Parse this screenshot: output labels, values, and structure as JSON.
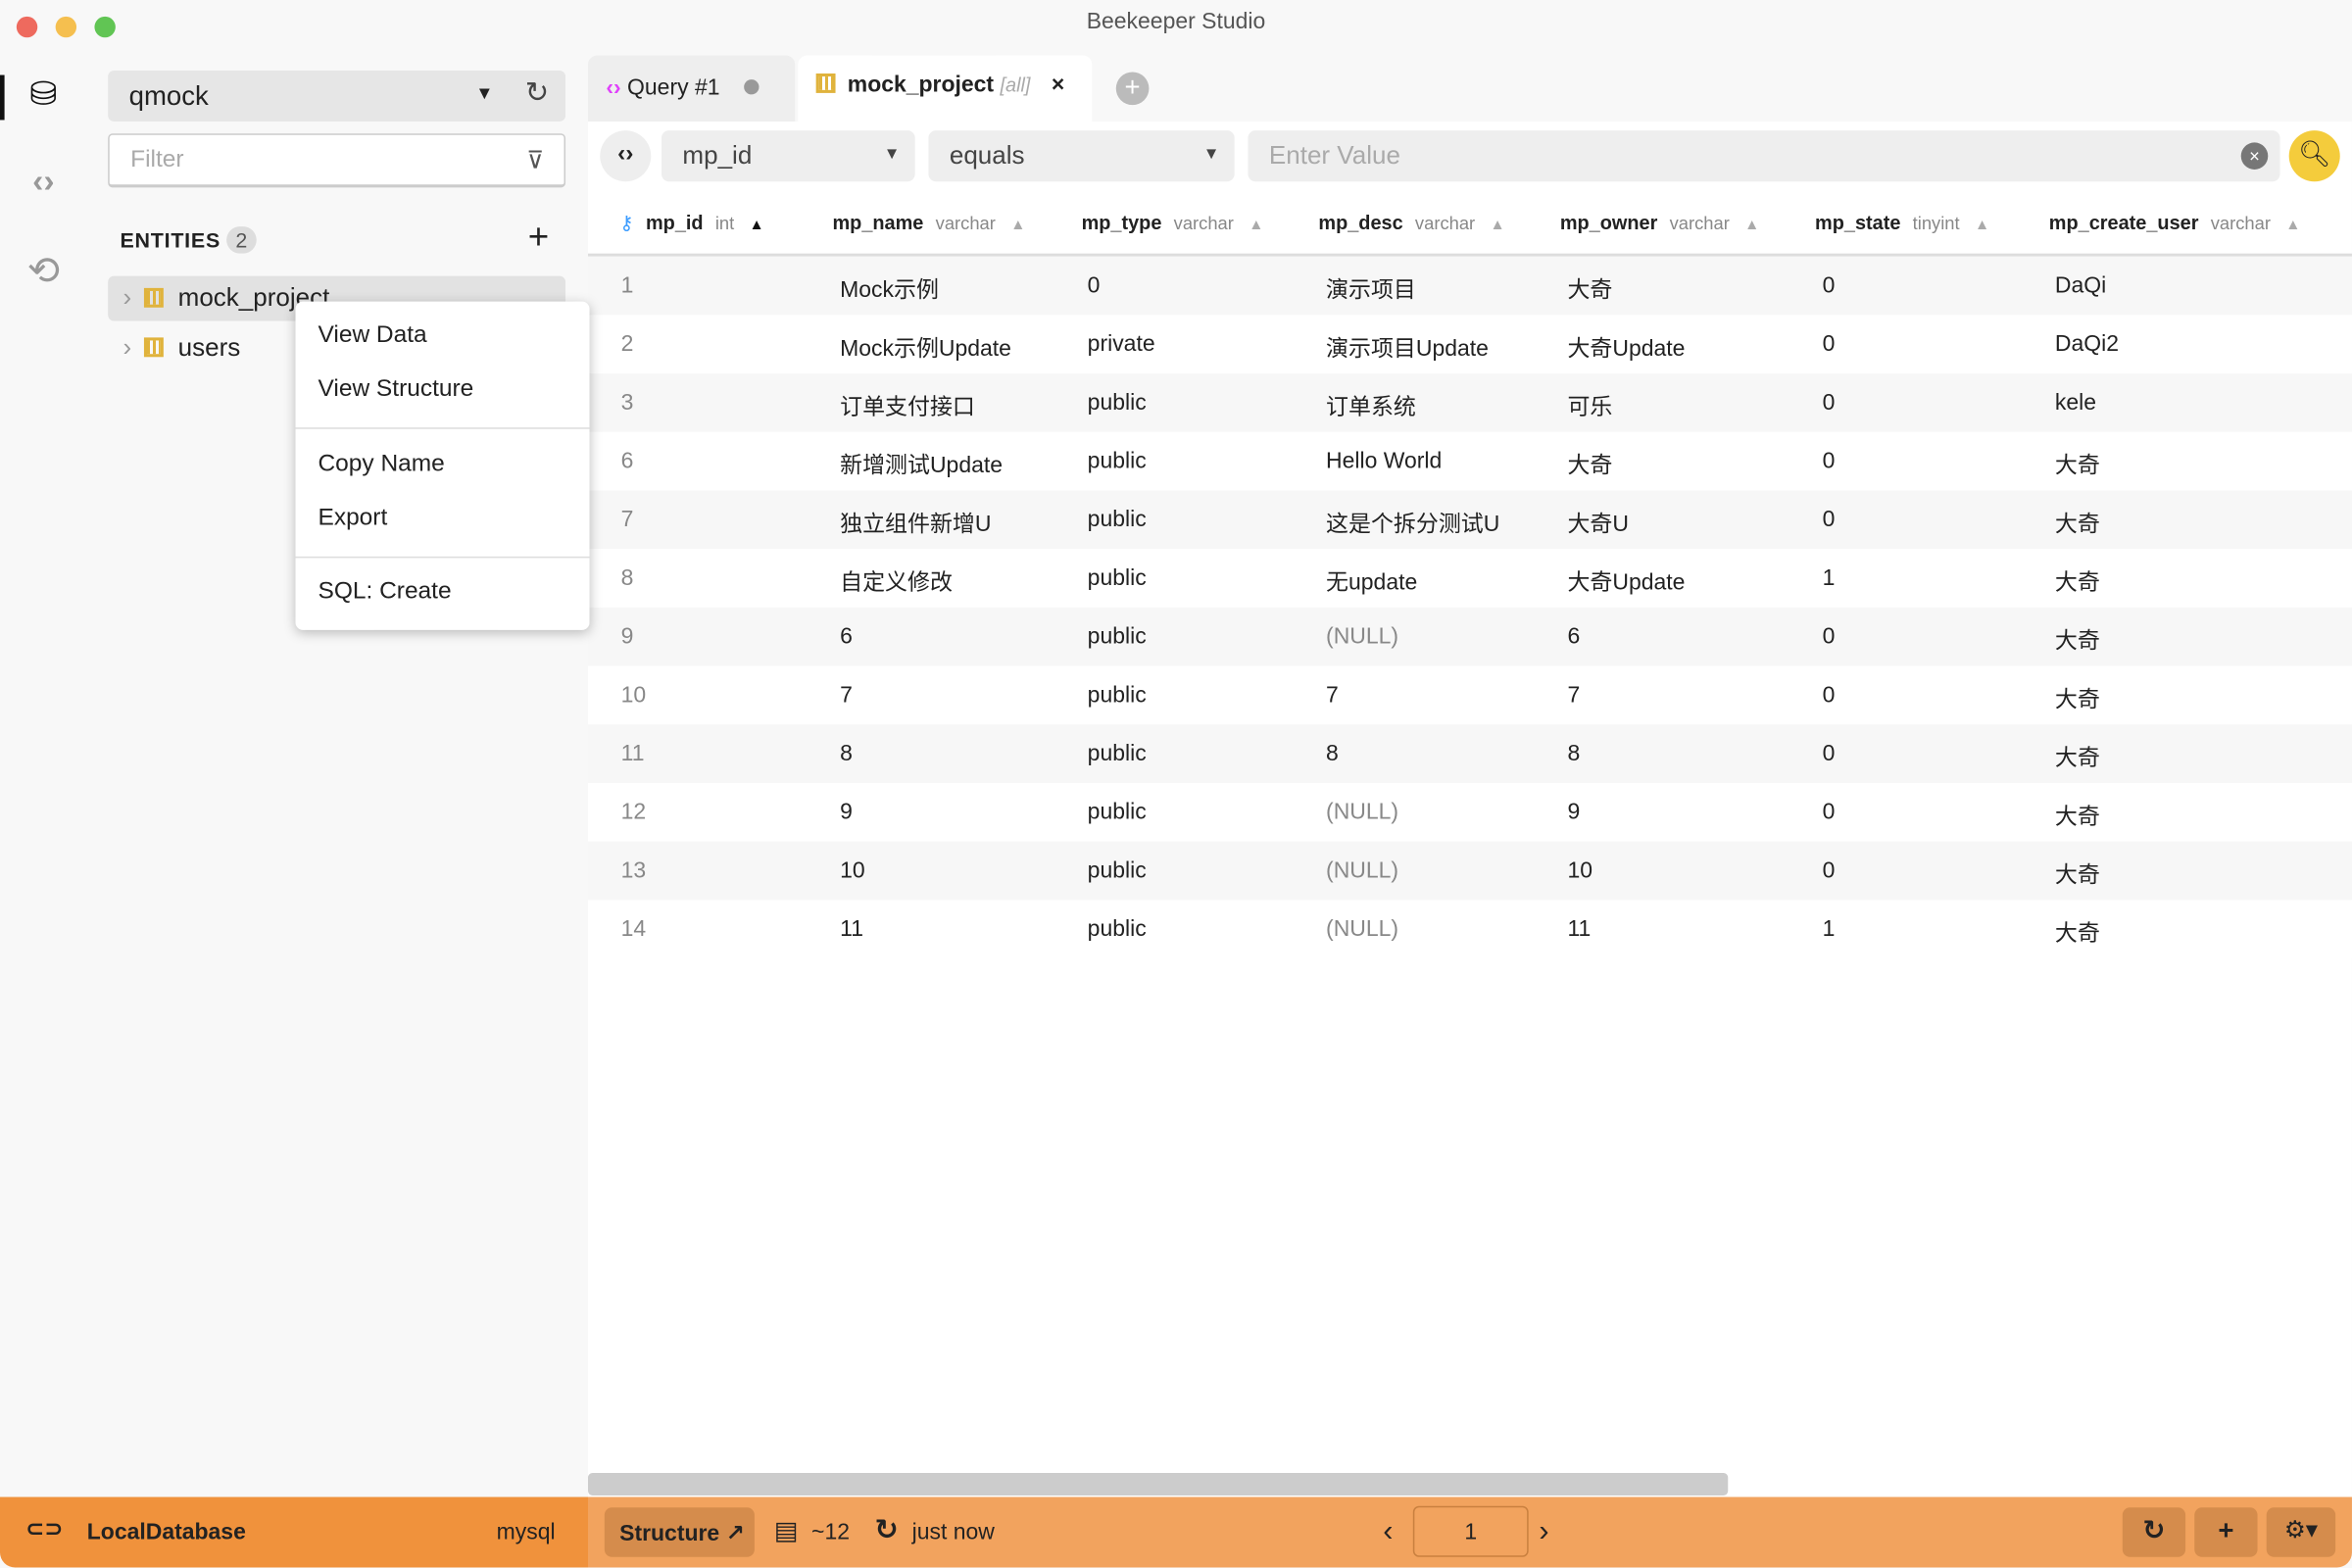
{
  "window": {
    "title": "Beekeeper Studio"
  },
  "colors": {
    "accent": "#f2a35e",
    "footer_left": "#f0923c",
    "search_button": "#f4cc3c",
    "query_icon": "#e040fb",
    "key_icon": "#3b9cff"
  },
  "rail": [
    "database-icon",
    "code-icon",
    "history-icon"
  ],
  "sidebar": {
    "connection": "qmock",
    "filter_placeholder": "Filter",
    "entities_label": "ENTITIES",
    "entities_count": "2",
    "items": [
      {
        "label": "mock_project"
      },
      {
        "label": "users"
      }
    ]
  },
  "context_menu": {
    "items": [
      "View Data",
      "View Structure",
      "Copy Name",
      "Export",
      "SQL: Create"
    ]
  },
  "tabs": [
    {
      "label": "Query #1"
    },
    {
      "label": "mock_project",
      "suffix": "[all]"
    }
  ],
  "filter": {
    "column": "mp_id",
    "operator": "equals",
    "value_placeholder": "Enter Value"
  },
  "table": {
    "columns": [
      {
        "name": "mp_id",
        "type": "int"
      },
      {
        "name": "mp_name",
        "type": "varchar"
      },
      {
        "name": "mp_type",
        "type": "varchar"
      },
      {
        "name": "mp_desc",
        "type": "varchar"
      },
      {
        "name": "mp_owner",
        "type": "varchar"
      },
      {
        "name": "mp_state",
        "type": "tinyint"
      },
      {
        "name": "mp_create_user",
        "type": "varchar"
      }
    ],
    "rows": [
      [
        "1",
        "Mock示例",
        "0",
        "演示项目",
        "大奇",
        "0",
        "DaQi"
      ],
      [
        "2",
        "Mock示例Update",
        "private",
        "演示项目Update",
        "大奇Update",
        "0",
        "DaQi2"
      ],
      [
        "3",
        "订单支付接口",
        "public",
        "订单系统",
        "可乐",
        "0",
        "kele"
      ],
      [
        "6",
        "新增测试Update",
        "public",
        "Hello World",
        "大奇",
        "0",
        "大奇"
      ],
      [
        "7",
        "独立组件新增U",
        "public",
        "这是个拆分测试U",
        "大奇U",
        "0",
        "大奇"
      ],
      [
        "8",
        "自定义修改",
        "public",
        "无update",
        "大奇Update",
        "1",
        "大奇"
      ],
      [
        "9",
        "6",
        "public",
        "(NULL)",
        "6",
        "0",
        "大奇"
      ],
      [
        "10",
        "7",
        "public",
        "7",
        "7",
        "0",
        "大奇"
      ],
      [
        "11",
        "8",
        "public",
        "8",
        "8",
        "0",
        "大奇"
      ],
      [
        "12",
        "9",
        "public",
        "(NULL)",
        "9",
        "0",
        "大奇"
      ],
      [
        "13",
        "10",
        "public",
        "(NULL)",
        "10",
        "0",
        "大奇"
      ],
      [
        "14",
        "11",
        "public",
        "(NULL)",
        "11",
        "1",
        "大奇"
      ]
    ]
  },
  "footer": {
    "connection": "LocalDatabase",
    "db_type": "mysql",
    "structure_label": "Structure ↗",
    "row_count": "~12",
    "updated": "just now",
    "page": "1"
  }
}
